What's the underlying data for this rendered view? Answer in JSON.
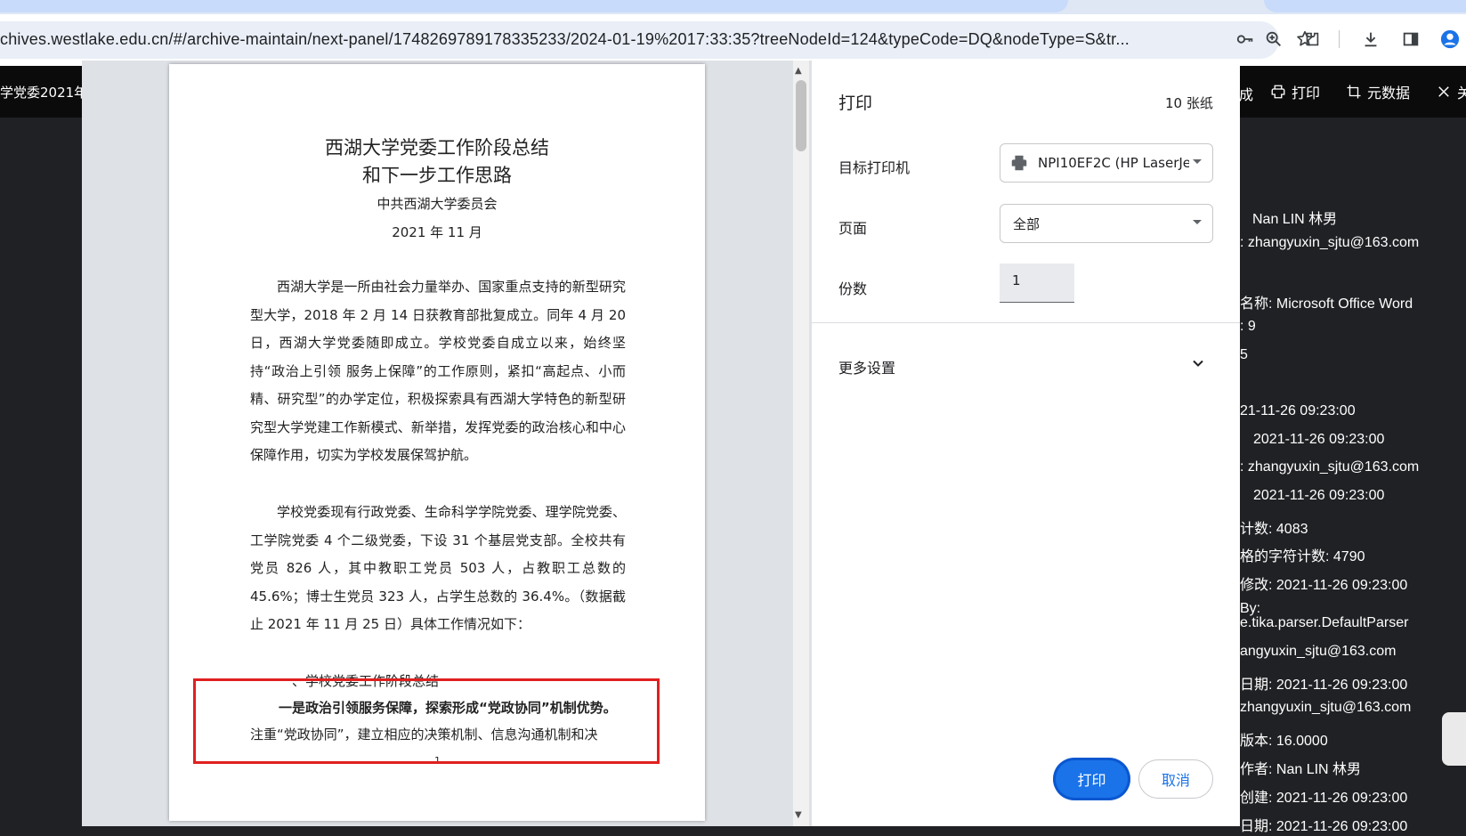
{
  "browser": {
    "url": "chives.westlake.edu.cn/#/archive-maintain/next-panel/1748269789178335233/2024-01-19%2017:33:35?treeNodeId=124&typeCode=DQ&nodeType=S&tr...",
    "toolbar_icons": [
      "key-icon",
      "zoom-icon",
      "star-icon",
      "extensions-icon",
      "download-icon",
      "sidebar-icon",
      "profile-icon"
    ]
  },
  "viewer": {
    "title_fragment": "学党委2021年",
    "header_fragment": "成",
    "print_label": "打印",
    "metadata_label": "元数据",
    "close_fragment": "关"
  },
  "metadata_rows": [
    "Nan LIN 林男",
    ":  zhangyuxin_sjtu@163.com",
    "名称:   Microsoft Office Word",
    ":   9",
    "5",
    "21-11-26 09:23:00",
    "2021-11-26 09:23:00",
    ":  zhangyuxin_sjtu@163.com",
    "2021-11-26 09:23:00",
    "计数:   4083",
    "格的字符计数:   4790",
    "修改:   2021-11-26 09:23:00",
    "By:",
    "e.tika.parser.DefaultParser",
    "angyuxin_sjtu@163.com",
    "日期:   2021-11-26 09:23:00",
    "zhangyuxin_sjtu@163.com",
    "版本:   16.0000",
    "作者:   Nan LIN 林男",
    "创建:   2021-11-26 09:23:00",
    "日期:   2021-11-26 09:23:00"
  ],
  "document": {
    "title_line1": "西湖大学党委工作阶段总结",
    "title_line2": "和下一步工作思路",
    "org": "中共西湖大学委员会",
    "date": "2021 年 11 月",
    "para1": "西湖大学是一所由社会力量举办、国家重点支持的新型研究型大学，2018 年 2 月 14 日获教育部批复成立。同年 4 月 20 日，西湖大学党委随即成立。学校党委自成立以来，始终坚持“政治上引领 服务上保障”的工作原则，紧扣“高起点、小而精、研究型”的办学定位，积极探索具有西湖大学特色的新型研究型大学党建工作新模式、新举措，发挥党委的政治核心和中心保障作用，切实为学校发展保驾护航。",
    "para2": "学校党委现有行政党委、生命科学学院党委、理学院党委、工学院党委 4 个二级党委，下设 31 个基层党支部。全校共有党员 826 人，其中教职工党员 503 人，占教职工总数的 45.6%；博士生党员 323 人，占学生总数的 36.4%。（数据截止 2021 年 11 月 25 日）具体工作情况如下：",
    "section_heading": "一、学校党委工作阶段总结",
    "bold_line": "一是政治引领服务保障，探索形成“党政协同”机制优势。",
    "tail_line": "注重“党政协同”，建立相应的决策机制、信息沟通机制和决",
    "page_number": "1"
  },
  "print_dialog": {
    "title": "打印",
    "sheets": "10 张纸",
    "destination_label": "目标打印机",
    "destination_value": "NPI10EF2C (HP LaserJet",
    "pages_label": "页面",
    "pages_value": "全部",
    "copies_label": "份数",
    "copies_value": "1",
    "more_settings": "更多设置",
    "print_button": "打印",
    "cancel_button": "取消"
  },
  "colors": {
    "accent": "#1a73e8",
    "highlight_box": "#e02020"
  }
}
